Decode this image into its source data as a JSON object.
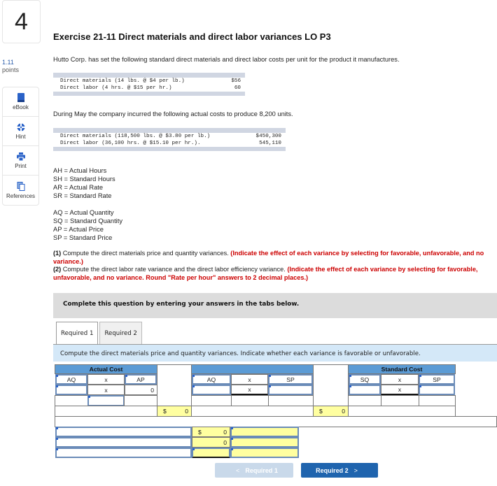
{
  "question": {
    "number": "4",
    "points_value": "1.11",
    "points_label": "points"
  },
  "sidebar": {
    "tools": [
      {
        "label": "eBook",
        "icon": "book-icon"
      },
      {
        "label": "Hint",
        "icon": "lifebuoy-icon"
      },
      {
        "label": "Print",
        "icon": "printer-icon"
      },
      {
        "label": "References",
        "icon": "documents-icon"
      }
    ]
  },
  "exercise": {
    "title": "Exercise 21-11 Direct materials and direct labor variances LO P3",
    "intro": "Hutto Corp. has set the following standard direct materials and direct labor costs per unit for the product it manufactures.",
    "standard_costs": [
      {
        "label": "Direct materials (14 lbs. @ $4 per lb.)",
        "value": "$56"
      },
      {
        "label": "Direct labor (4 hrs. @ $15 per hr.)",
        "value": "60"
      }
    ],
    "actual_intro": "During May the company incurred the following actual costs to produce 8,200 units.",
    "actual_costs": [
      {
        "label": "Direct materials (118,500 lbs. @ $3.80 per lb.)",
        "value": "$450,300"
      },
      {
        "label": "Direct labor (36,100 hrs. @ $15.10 per hr.).",
        "value": "545,110"
      }
    ],
    "definitions_hours": [
      "AH = Actual Hours",
      "SH = Standard Hours",
      "AR = Actual Rate",
      "SR = Standard Rate"
    ],
    "definitions_quantity": [
      "AQ = Actual Quantity",
      "SQ = Standard Quantity",
      "AP = Actual Price",
      "SP = Standard Price"
    ],
    "instruction1_num": "(1)",
    "instruction1_text": " Compute the direct materials price and quantity variances. ",
    "instruction1_red": "(Indicate the effect of each variance by selecting for favorable, unfavorable, and no variance.)",
    "instruction2_num": "(2)",
    "instruction2_text": " Compute the direct labor rate variance and the direct labor efficiency variance. ",
    "instruction2_red": "(Indicate the effect of each variance by selecting for favorable, unfavorable, and no variance. Round \"Rate per hour\" answers to 2 decimal places.)"
  },
  "answer_area": {
    "banner": "Complete this question by entering your answers in the tabs below.",
    "tabs": [
      {
        "label": "Required 1",
        "active": true
      },
      {
        "label": "Required 2",
        "active": false
      }
    ],
    "prompt": "Compute the direct materials price and quantity variances. Indicate whether each variance is favorable or unfavorable.",
    "grid": {
      "actual_cost_header": "Actual Cost",
      "standard_cost_header": "Standard Cost",
      "col_aq": "AQ",
      "col_x": "x",
      "col_ap": "AP",
      "col_sp": "SP",
      "col_sq": "SQ",
      "actual_ap_value": "0",
      "currency": "$",
      "total_actual": "0",
      "total_middle": "0",
      "variance1_value": "0",
      "variance2_value": "0"
    },
    "nav": {
      "prev_label": "Required 1",
      "next_label": "Required 2",
      "prev_chevron": "<",
      "next_chevron": ">"
    }
  },
  "colors": {
    "accent_blue": "#1f64ae",
    "header_blue": "#5b9bd5",
    "input_yellow": "#ffffa0",
    "instruction_red": "#cc0000"
  }
}
